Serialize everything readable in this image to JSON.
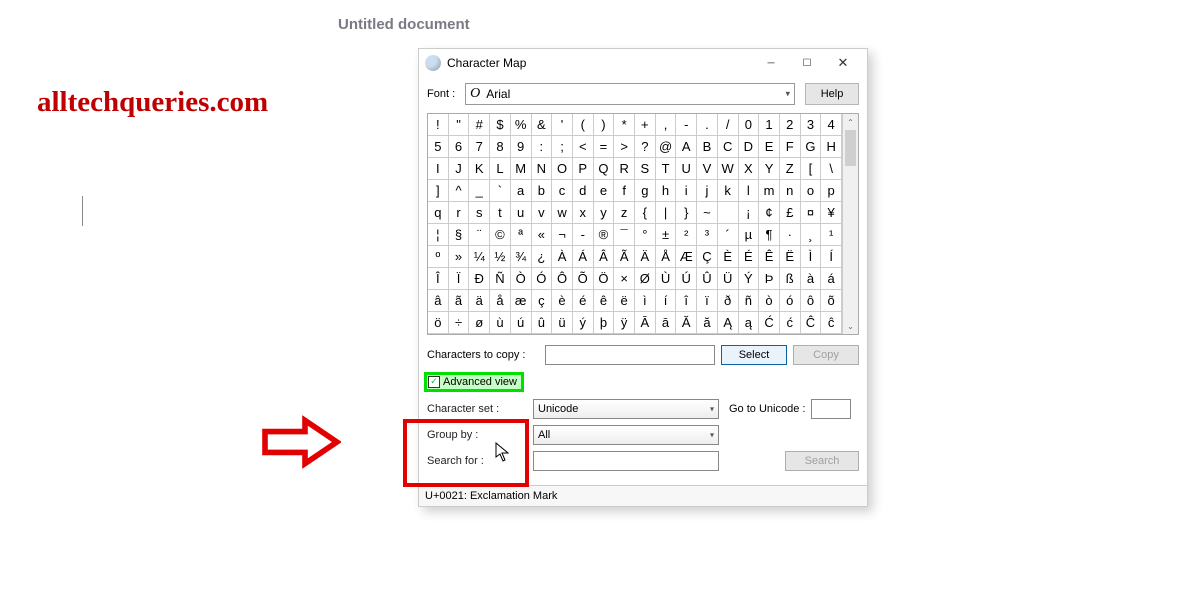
{
  "meta": {
    "document_title": "Untitled document",
    "watermark": "alltechqueries.com"
  },
  "window": {
    "title": "Character Map",
    "font_label": "Font :",
    "font_value": "Arial",
    "help_label": "Help",
    "characters_to_copy_label": "Characters to copy :",
    "characters_to_copy_value": "",
    "select_label": "Select",
    "copy_label": "Copy",
    "advanced_view_label": "Advanced view",
    "character_set_label": "Character set :",
    "character_set_value": "Unicode",
    "go_to_unicode_label": "Go to Unicode :",
    "go_to_unicode_value": "",
    "group_by_label": "Group by :",
    "group_by_value": "All",
    "search_for_label": "Search for :",
    "search_for_value": "",
    "search_button_label": "Search",
    "status": "U+0021: Exclamation Mark"
  },
  "grid_rows": [
    [
      "!",
      "\"",
      "#",
      "$",
      "%",
      "&",
      "'",
      "(",
      ")",
      "*",
      "+",
      ",",
      "-",
      ".",
      "/",
      "0",
      "1",
      "2",
      "3",
      "4"
    ],
    [
      "5",
      "6",
      "7",
      "8",
      "9",
      ":",
      ";",
      "<",
      "=",
      ">",
      "?",
      "@",
      "A",
      "B",
      "C",
      "D",
      "E",
      "F",
      "G",
      "H"
    ],
    [
      "I",
      "J",
      "K",
      "L",
      "M",
      "N",
      "O",
      "P",
      "Q",
      "R",
      "S",
      "T",
      "U",
      "V",
      "W",
      "X",
      "Y",
      "Z",
      "[",
      "\\"
    ],
    [
      "]",
      "^",
      "_",
      "`",
      "a",
      "b",
      "c",
      "d",
      "e",
      "f",
      "g",
      "h",
      "i",
      "j",
      "k",
      "l",
      "m",
      "n",
      "o",
      "p"
    ],
    [
      "q",
      "r",
      "s",
      "t",
      "u",
      "v",
      "w",
      "x",
      "y",
      "z",
      "{",
      "|",
      "}",
      "~",
      "",
      "¡",
      "¢",
      "£",
      "¤",
      "¥"
    ],
    [
      "¦",
      "§",
      "¨",
      "©",
      "ª",
      "«",
      "¬",
      "-",
      "®",
      "¯",
      "°",
      "±",
      "²",
      "³",
      "´",
      "µ",
      "¶",
      "·",
      "¸",
      "¹"
    ],
    [
      "º",
      "»",
      "¼",
      "½",
      "¾",
      "¿",
      "À",
      "Á",
      "Â",
      "Ã",
      "Ä",
      "Å",
      "Æ",
      "Ç",
      "È",
      "É",
      "Ê",
      "Ë",
      "Ì",
      "Í"
    ],
    [
      "Î",
      "Ï",
      "Ð",
      "Ñ",
      "Ò",
      "Ó",
      "Ô",
      "Õ",
      "Ö",
      "×",
      "Ø",
      "Ù",
      "Ú",
      "Û",
      "Ü",
      "Ý",
      "Þ",
      "ß",
      "à",
      "á"
    ],
    [
      "â",
      "ã",
      "ä",
      "å",
      "æ",
      "ç",
      "è",
      "é",
      "ê",
      "ë",
      "ì",
      "í",
      "î",
      "ï",
      "ð",
      "ñ",
      "ò",
      "ó",
      "ô",
      "õ"
    ],
    [
      "ö",
      "÷",
      "ø",
      "ù",
      "ú",
      "û",
      "ü",
      "ý",
      "þ",
      "ÿ",
      "Ā",
      "ā",
      "Ă",
      "ă",
      "Ą",
      "ą",
      "Ć",
      "ć",
      "Ĉ",
      "ĉ"
    ]
  ]
}
